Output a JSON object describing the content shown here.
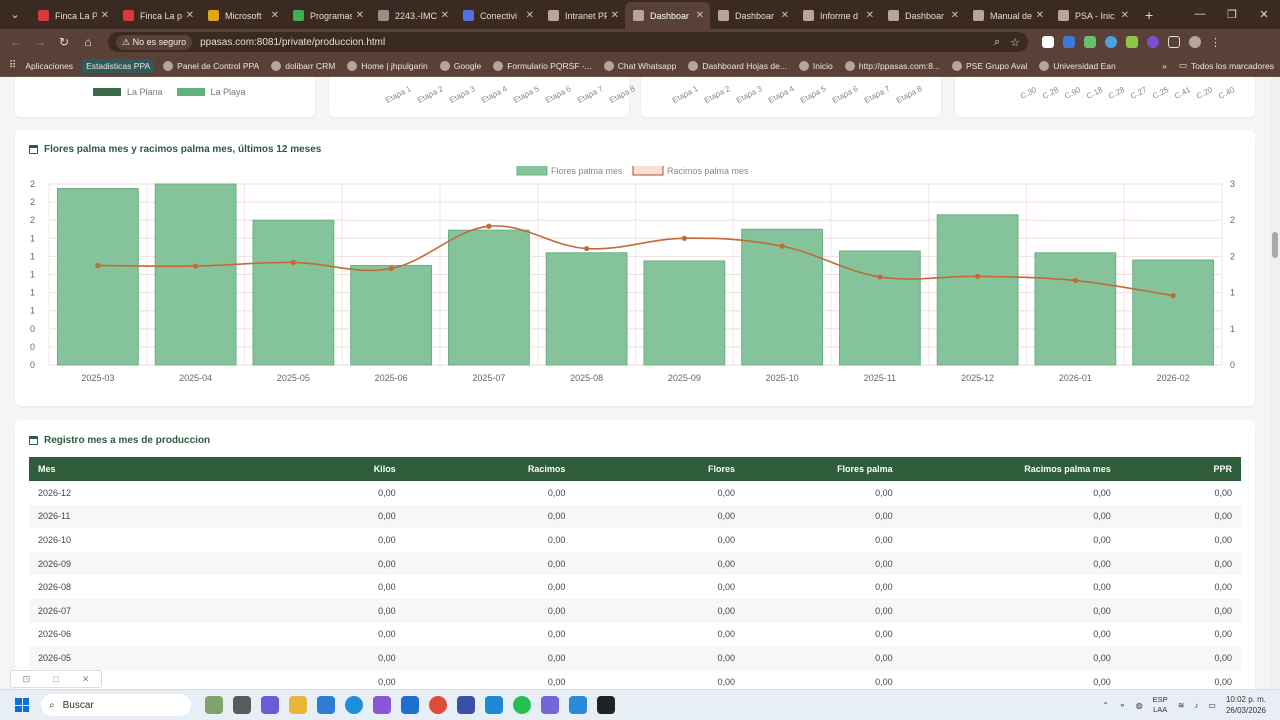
{
  "browser": {
    "tabs": [
      {
        "label": "Finca La P",
        "color": "#d93b3b",
        "active": false
      },
      {
        "label": "Finca La pl",
        "color": "#d93b3b",
        "active": false
      },
      {
        "label": "Microsoft",
        "color": "#e0a419",
        "active": false
      },
      {
        "label": "Programas",
        "color": "#3fae52",
        "active": false
      },
      {
        "label": "2243.-IMC",
        "color": "#9a8f8a",
        "active": false
      },
      {
        "label": "Conectivi",
        "color": "#5b6ee1",
        "active": false
      },
      {
        "label": "Intranet PF",
        "color": "#b7a59c",
        "active": false
      },
      {
        "label": "Dashboar",
        "color": "#b7a59c",
        "active": true
      },
      {
        "label": "Dashboar",
        "color": "#b7a59c",
        "active": false
      },
      {
        "label": "Informe d",
        "color": "#b7a59c",
        "active": false
      },
      {
        "label": "Dashboar",
        "color": "#b7a59c",
        "active": false
      },
      {
        "label": "Manual de",
        "color": "#b7a59c",
        "active": false
      },
      {
        "label": "PSA - Inic",
        "color": "#b7a59c",
        "active": false
      }
    ],
    "close_glyph": "✕",
    "new_tab": "+",
    "security_label": "No es seguro",
    "url": "ppasas.com:8081/private/produccion.html",
    "bookmarks": [
      {
        "label": "Aplicaciones",
        "highlight": false
      },
      {
        "label": "Estadisticas PPA",
        "highlight": true
      },
      {
        "label": "Panel de Control PPA",
        "highlight": false
      },
      {
        "label": "dolibarr CRM",
        "highlight": false
      },
      {
        "label": "Home | jhpulgarin",
        "highlight": false
      },
      {
        "label": "Google",
        "highlight": false
      },
      {
        "label": "Formulario PQRSF -...",
        "highlight": false
      },
      {
        "label": "Chat Whatsapp",
        "highlight": false
      },
      {
        "label": "Dashboard Hojas de...",
        "highlight": false
      },
      {
        "label": "Inicio",
        "highlight": false
      },
      {
        "label": "http://ppasas.com:8...",
        "highlight": false
      },
      {
        "label": "PSE Grupo Aval",
        "highlight": false
      },
      {
        "label": "Universidad Ean",
        "highlight": false
      }
    ],
    "all_bookmarks": "Todos los marcadores"
  },
  "top_cards": {
    "legend": [
      {
        "name": "La Plana",
        "color": "#3a6b4a"
      },
      {
        "name": "La Playa",
        "color": "#5fb37f"
      }
    ],
    "etapas_a": [
      "Etapa 1",
      "Etapa 2",
      "Etapa 3",
      "Etapa 4",
      "Etapa 5",
      "Etapa 6",
      "Etapa 7",
      "Etapa 8"
    ],
    "etapas_b": [
      "Etapa 1",
      "Etapa 2",
      "Etapa 3",
      "Etapa 4",
      "Etapa 5",
      "Etapa 6",
      "Etapa 7",
      "Etapa 8"
    ],
    "lotes": [
      "C.30",
      "C.28",
      "C.90",
      "C.18",
      "C.28",
      "C.27",
      "C.25",
      "C.41",
      "C.20",
      "C.40"
    ]
  },
  "chart_card": {
    "title": "Flores palma mes y racimos palma mes, últimos 12 meses"
  },
  "chart_data": {
    "type": "bar",
    "categories": [
      "2025-03",
      "2025-04",
      "2025-05",
      "2025-06",
      "2025-07",
      "2025-08",
      "2025-09",
      "2025-10",
      "2025-11",
      "2025-12",
      "2026-01",
      "2026-02"
    ],
    "series": [
      {
        "name": "Flores palma mes",
        "type": "bar",
        "axis": "left",
        "color": "#85c49a",
        "values": [
          1.95,
          2.0,
          1.6,
          1.1,
          1.49,
          1.24,
          1.15,
          1.5,
          1.26,
          1.66,
          1.24,
          1.16
        ]
      },
      {
        "name": "Racimos palma mes",
        "type": "line",
        "axis": "right",
        "color": "#c06a3a",
        "values": [
          1.65,
          1.64,
          1.7,
          1.6,
          2.3,
          1.93,
          2.1,
          1.97,
          1.46,
          1.47,
          1.4,
          1.15
        ]
      }
    ],
    "ylim_left": [
      0,
      2.0
    ],
    "ylim_right": [
      0,
      3
    ],
    "left_ticks": [
      "2",
      "2",
      "2",
      "1",
      "1",
      "1",
      "1",
      "1",
      "0",
      "0",
      "0"
    ],
    "right_ticks": [
      "3",
      "2",
      "2",
      "1",
      "1",
      "0"
    ],
    "grid": true,
    "legend_position": "top-center"
  },
  "table_card": {
    "title": "Registro mes a mes de produccion",
    "columns": [
      "Mes",
      "Kilos",
      "Racimos",
      "Flores",
      "Flores palma",
      "Racimos palma mes",
      "PPR"
    ],
    "rows": [
      [
        "2026-12",
        "0,00",
        "0,00",
        "0,00",
        "0,00",
        "0,00",
        "0,00"
      ],
      [
        "2026-11",
        "0,00",
        "0,00",
        "0,00",
        "0,00",
        "0,00",
        "0,00"
      ],
      [
        "2026-10",
        "0,00",
        "0,00",
        "0,00",
        "0,00",
        "0,00",
        "0,00"
      ],
      [
        "2026-09",
        "0,00",
        "0,00",
        "0,00",
        "0,00",
        "0,00",
        "0,00"
      ],
      [
        "2026-08",
        "0,00",
        "0,00",
        "0,00",
        "0,00",
        "0,00",
        "0,00"
      ],
      [
        "2026-07",
        "0,00",
        "0,00",
        "0,00",
        "0,00",
        "0,00",
        "0,00"
      ],
      [
        "2026-06",
        "0,00",
        "0,00",
        "0,00",
        "0,00",
        "0,00",
        "0,00"
      ],
      [
        "2026-05",
        "0,00",
        "0,00",
        "0,00",
        "0,00",
        "0,00",
        "0,00"
      ],
      [
        "",
        "0,00",
        "0,00",
        "0,00",
        "0,00",
        "0,00",
        "0,00"
      ]
    ]
  },
  "taskbar": {
    "search_placeholder": "Buscar",
    "lang_line1": "ESP",
    "lang_line2": "LAA",
    "time": "10:02 p. m.",
    "date": "26/03/2026"
  }
}
